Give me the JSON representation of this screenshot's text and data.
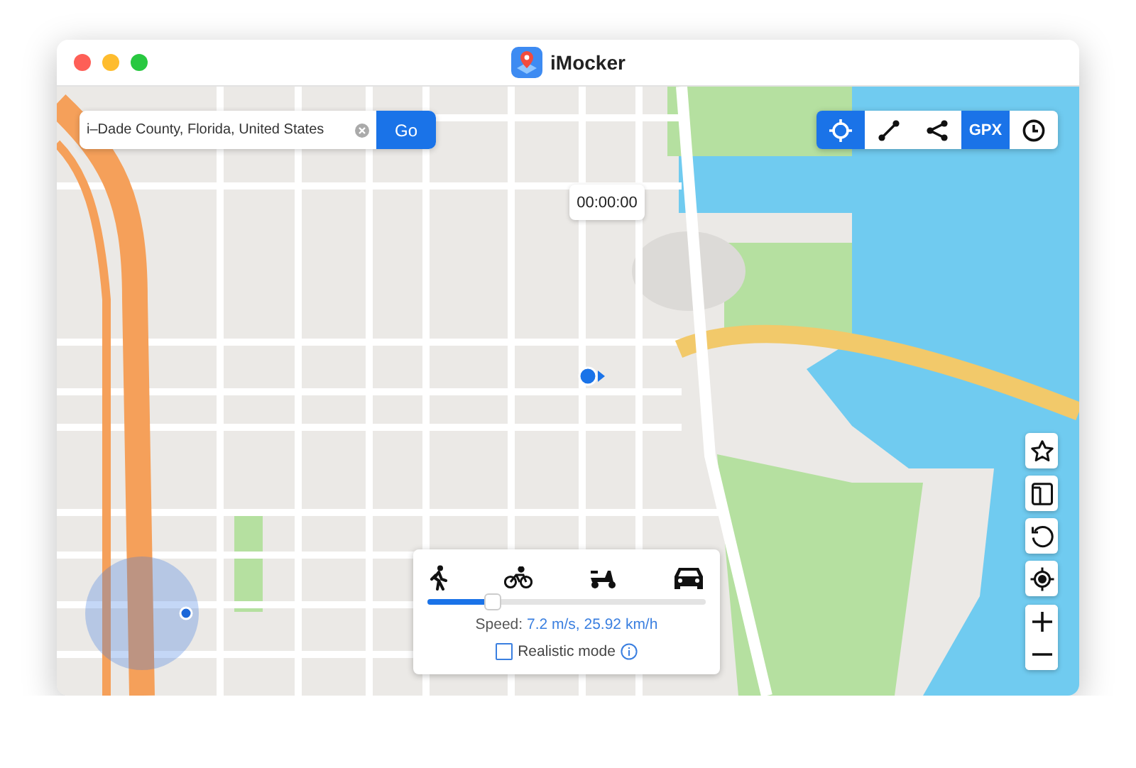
{
  "window": {
    "title": "iMocker"
  },
  "search": {
    "value": "i–Dade County, Florida, United States",
    "button": "Go"
  },
  "toolbar": [
    {
      "kind": "teleport",
      "selected": true
    },
    {
      "kind": "route",
      "selected": false
    },
    {
      "kind": "multi",
      "selected": false
    },
    {
      "kind": "gpx",
      "label": "GPX",
      "selected": true
    },
    {
      "kind": "history",
      "selected": false
    }
  ],
  "timer": "00:00:00",
  "side_buttons": [
    {
      "kind": "favorite"
    },
    {
      "kind": "device"
    },
    {
      "kind": "reset"
    },
    {
      "kind": "locate"
    }
  ],
  "zoom_buttons": [
    {
      "kind": "in"
    },
    {
      "kind": "out"
    }
  ],
  "speed_panel": {
    "modes": [
      {
        "kind": "walk"
      },
      {
        "kind": "bike"
      },
      {
        "kind": "scooter"
      },
      {
        "kind": "car"
      }
    ],
    "level": 0.23,
    "label": "Speed:",
    "value": "7.2 m/s, 25.92 km/h",
    "realistic": {
      "label": "Realistic mode",
      "checked": false
    }
  }
}
